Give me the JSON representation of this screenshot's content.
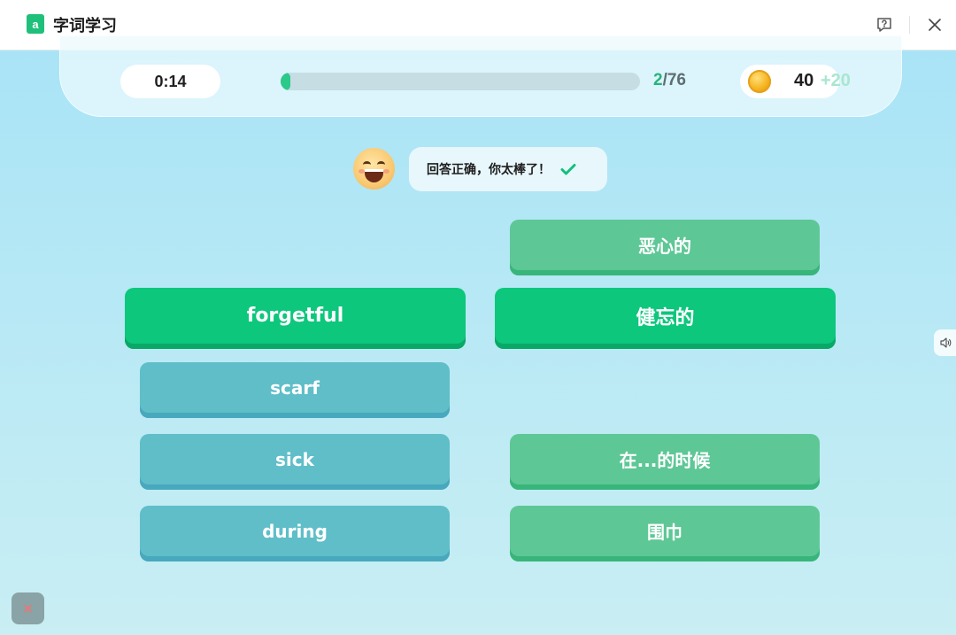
{
  "titlebar": {
    "app_logo_letter": "a",
    "title": "字词学习",
    "feedback_icon": "question-chat-icon",
    "close_icon": "close-icon"
  },
  "status": {
    "timer": "0:14",
    "progress_current": "2",
    "progress_total": "/76",
    "progress_fraction": 0.026,
    "coins": "40",
    "coins_bonus": "+20"
  },
  "feedback": {
    "message": "回答正确，你太棒了！",
    "emoji": "laughing-face-icon",
    "check_icon": "check-icon"
  },
  "english_words": [
    {
      "label": "forgetful",
      "state": "matched"
    },
    {
      "label": "scarf",
      "state": "idle"
    },
    {
      "label": "sick",
      "state": "idle"
    },
    {
      "label": "during",
      "state": "idle"
    }
  ],
  "chinese_meanings": [
    {
      "label": "恶心的",
      "state": "idle"
    },
    {
      "label": "健忘的",
      "state": "matched"
    },
    {
      "label": "在...的时候",
      "state": "idle"
    },
    {
      "label": "围巾",
      "state": "idle"
    }
  ],
  "side": {
    "speaker_icon": "speaker-icon"
  },
  "quit": {
    "symbol": "×"
  },
  "colors": {
    "accent_green": "#0cc77c",
    "card_blue": "#5fbec8",
    "card_green": "#5ec796",
    "coin_gold": "#f5b21e"
  }
}
